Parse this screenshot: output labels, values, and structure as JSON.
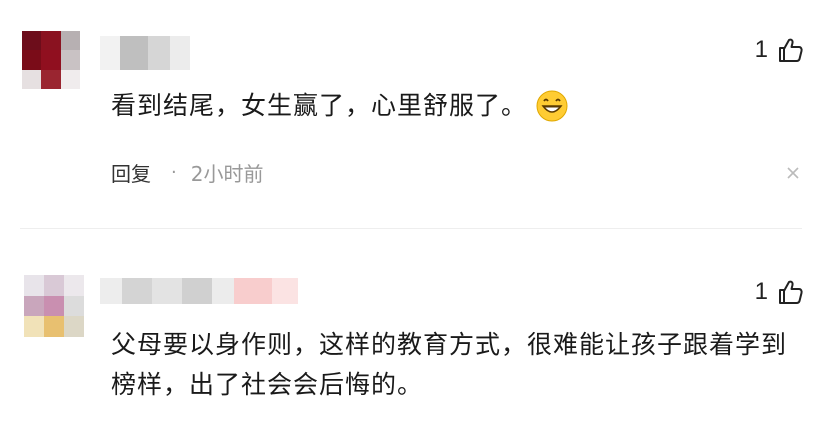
{
  "comments": [
    {
      "text": "看到结尾，女生赢了，心里舒服了。",
      "emoji": "grin-icon",
      "likes": "1",
      "reply_label": "回复",
      "dot": "·",
      "time": "2小时前"
    },
    {
      "text": "父母要以身作则，这样的教育方式，很难能让孩子跟着学到榜样，出了社会会后悔的。",
      "likes": "1"
    }
  ],
  "colors": {
    "avatar1": [
      "#6d0d1b",
      "#8a1220",
      "#b7b0b2",
      "#7a0c18",
      "#900f1f",
      "#c9c2c4",
      "#e6e0e1",
      "#9a2530",
      "#f0eced"
    ],
    "avatar2": [
      "#e8e4ea",
      "#d9c9d6",
      "#ece8ec",
      "#c9a6bc",
      "#c98fb0",
      "#dcdcdc",
      "#f1e2b8",
      "#e8c070",
      "#dcd7c6"
    ],
    "name1": [
      "#f2f2f2",
      "#bfbfbf",
      "#d6d6d6",
      "#ececec"
    ],
    "name2": [
      "#ededed",
      "#d4d4d4",
      "#e3e3e3",
      "#d0d0d0",
      "#ececec",
      "#f8cdcd",
      "#fbe3e3"
    ]
  }
}
